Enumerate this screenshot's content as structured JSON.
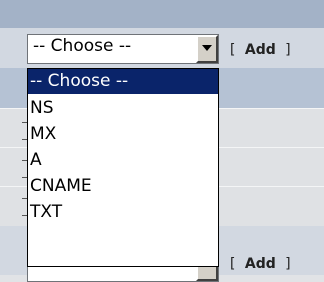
{
  "row1": {
    "select_value": "-- Choose --",
    "add_label": "Add"
  },
  "row2": {
    "add_label": "Add"
  },
  "dropdown": {
    "options": [
      "-- Choose --",
      "NS",
      "MX",
      "A",
      "CNAME",
      "TXT"
    ],
    "selected_index": 0
  },
  "colors": {
    "header": "#a3b2c7",
    "selection": "#0a246a"
  },
  "icons": {
    "select_arrow": "chevron-down-icon"
  }
}
